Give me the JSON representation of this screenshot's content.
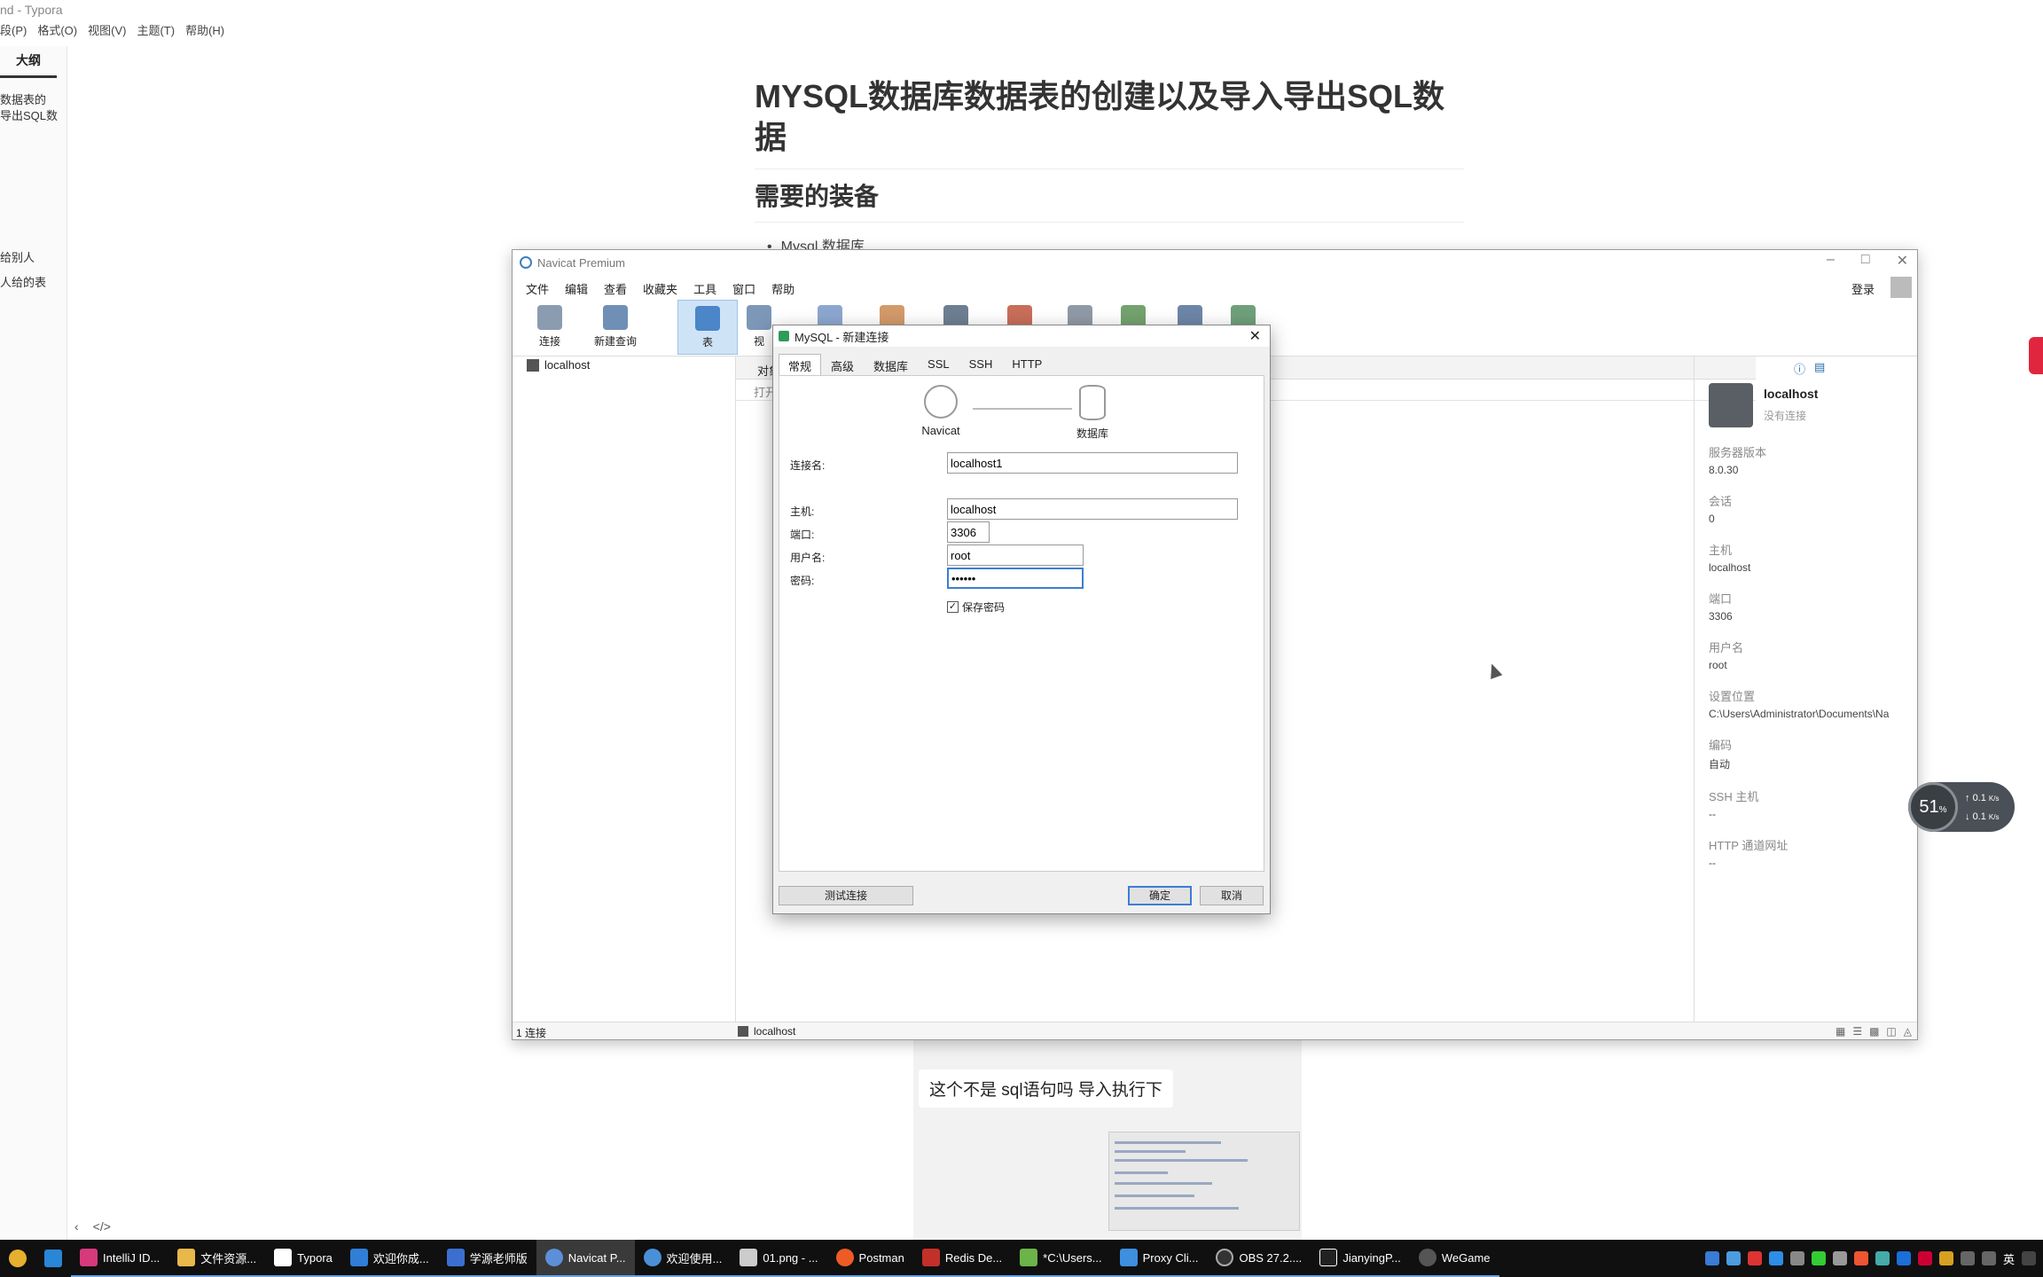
{
  "typora": {
    "window_title": "nd - Typora",
    "menu": [
      "段(P)",
      "格式(O)",
      "视图(V)",
      "主题(T)",
      "帮助(H)"
    ],
    "sidebar_tab": "大纲",
    "outline": [
      "数据表的",
      "导出SQL数",
      "给别人",
      "人给的表"
    ],
    "bottom_icons": [
      "‹",
      "</>"
    ],
    "doc_title": "MYSQL数据库数据表的创建以及导入导出SQL数据",
    "doc_h2": "需要的装备",
    "doc_bullet": "Mysql 数据库"
  },
  "chat": {
    "message": "这个不是 sql语句吗  导入执行下"
  },
  "navicat": {
    "title": "Navicat Premium",
    "menu": [
      "文件",
      "编辑",
      "查看",
      "收藏夹",
      "工具",
      "窗口",
      "帮助"
    ],
    "login": "登录",
    "toolbar": {
      "connect": "连接",
      "new_query": "新建查询",
      "table": "表",
      "view": "视",
      "chart": "表"
    },
    "connection": "localhost",
    "center_tab": "对象",
    "search_label": "打开",
    "right_pane": {
      "name": "localhost",
      "status": "没有连接",
      "fields": [
        {
          "k": "服务器版本",
          "v": "8.0.30"
        },
        {
          "k": "会话",
          "v": "0"
        },
        {
          "k": "主机",
          "v": "localhost"
        },
        {
          "k": "端口",
          "v": "3306"
        },
        {
          "k": "用户名",
          "v": "root"
        },
        {
          "k": "设置位置",
          "v": "C:\\Users\\Administrator\\Documents\\Na"
        },
        {
          "k": "编码",
          "v": "自动"
        },
        {
          "k": "SSH 主机",
          "v": "--"
        },
        {
          "k": "HTTP 通道网址",
          "v": "--"
        }
      ]
    },
    "status_left": "1 连接",
    "status_mid": "localhost"
  },
  "dialog": {
    "title": "MySQL - 新建连接",
    "tabs": [
      "常规",
      "高级",
      "数据库",
      "SSL",
      "SSH",
      "HTTP"
    ],
    "diagram_left": "Navicat",
    "diagram_right": "数据库",
    "conn_name_label": "连接名:",
    "conn_name": "localhost1",
    "host_label": "主机:",
    "host": "localhost",
    "port_label": "端口:",
    "port": "3306",
    "user_label": "用户名:",
    "user": "root",
    "password_label": "密码:",
    "password": "••••••",
    "save_password": "保存密码",
    "save_password_checked": true,
    "test_button": "测试连接",
    "ok_button": "确定",
    "cancel_button": "取消"
  },
  "net_widget": {
    "percent": "51",
    "percent_unit": "%",
    "up": "0.1",
    "down": "0.1",
    "unit": "K/s"
  },
  "taskbar": {
    "items": [
      "IntelliJ ID...",
      "文件资源...",
      "Typora",
      "欢迎你成...",
      "学源老师版",
      "Navicat P...",
      "欢迎使用...",
      "01.png - ...",
      "Postman",
      "Redis De...",
      "*C:\\Users...",
      "Proxy Cli...",
      "OBS 27.2....",
      "JianyingP...",
      "WeGame"
    ],
    "ime": "英"
  },
  "colors": {
    "accent_blue": "#3c7fd0",
    "taskbar": "#101010",
    "active_toolbar": "#cfe3f7",
    "red_tab": "#e0263e"
  }
}
